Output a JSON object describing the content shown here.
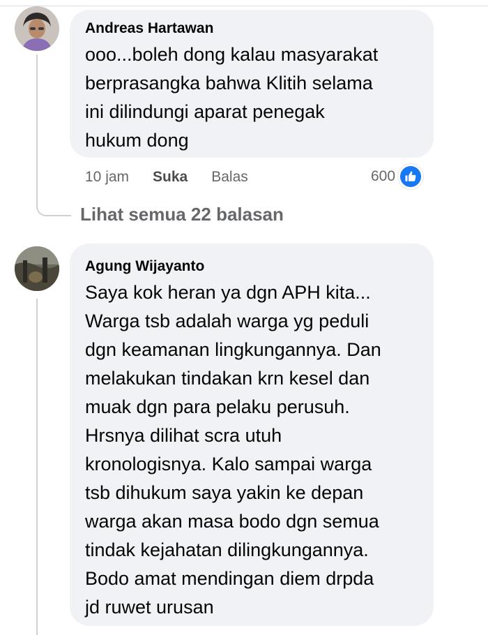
{
  "comments": [
    {
      "author": "Andreas Hartawan",
      "text": "ooo...boleh dong kalau masyarakat\nberprasangka bahwa Klitih selama\nini dilindungi aparat penegak\nhukum dong",
      "time": "10 jam",
      "like_label": "Suka",
      "reply_label": "Balas",
      "reaction_count": "600",
      "reaction_icon": "thumbs-up-icon",
      "reaction_color": "#1877f2"
    },
    {
      "author": "Agung Wijayanto",
      "text": "Saya kok heran ya dgn APH kita...\nWarga tsb adalah warga yg peduli\ndgn keamanan lingkungannya. Dan\nmelakukan tindakan krn kesel dan\nmuak dgn para pelaku perusuh.\nHrsnya dilihat scra utuh\nkronologisnya. Kalo sampai warga\ntsb dihukum saya yakin ke depan\nwarga akan masa bodo dgn semua\ntindak kejahatan dilingkungannya.\nBodo amat mendingan diem drpda\njd ruwet urusan"
    }
  ],
  "view_replies_label": "Lihat semua 22 balasan",
  "colors": {
    "bubble": "#f0f2f5",
    "text": "#050505",
    "secondary": "#65676b",
    "thread_line": "#ced0d4"
  }
}
